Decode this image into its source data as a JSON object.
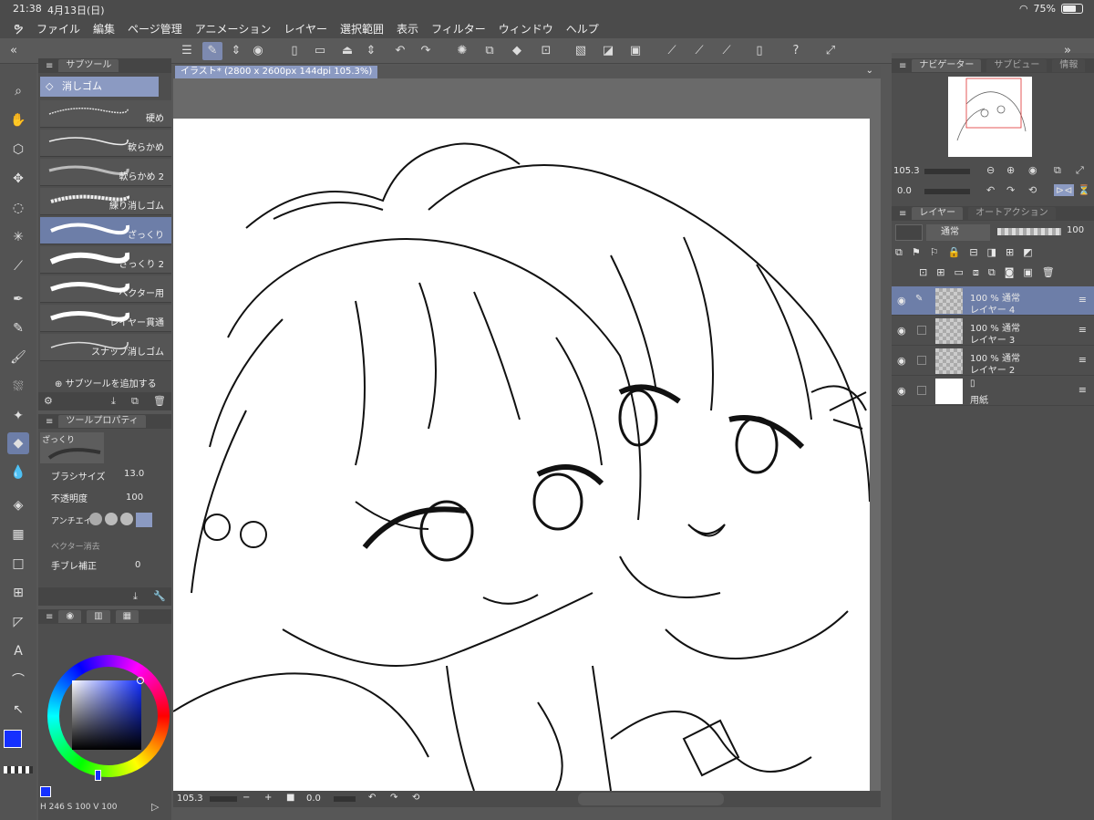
{
  "status": {
    "time": "21:38",
    "date": "4月13日(日)",
    "battery": "75%"
  },
  "menu": [
    "ファイル",
    "編集",
    "ページ管理",
    "アニメーション",
    "レイヤー",
    "選択範囲",
    "表示",
    "フィルター",
    "ウィンドウ",
    "ヘルプ"
  ],
  "subtool_panel": {
    "tab": "サブツール",
    "group": "消しゴム",
    "items": [
      {
        "label": "硬め"
      },
      {
        "label": "軟らかめ"
      },
      {
        "label": "軟らかめ 2"
      },
      {
        "label": "練り消しゴム"
      },
      {
        "label": "ざっくり"
      },
      {
        "label": "ざっくり 2"
      },
      {
        "label": "ベクター用"
      },
      {
        "label": "レイヤー貫通"
      },
      {
        "label": "スナップ消しゴム"
      }
    ],
    "add_label": "サブツールを追加する"
  },
  "tool_property": {
    "tab": "ツールプロパティ",
    "preset_name": "ざっくり",
    "brush_size_label": "ブラシサイズ",
    "brush_size_value": "13.0",
    "opacity_label": "不透明度",
    "opacity_value": "100",
    "antialias_label": "アンチエイリ",
    "vector_erase_label": "ベクター消去",
    "stabilizer_label": "手ブレ補正",
    "stabilizer_value": "0"
  },
  "color": {
    "main_color": "#1430ff",
    "values_label": "H 246 S 100 V 100"
  },
  "document": {
    "tab_title": "イラスト* (2800 x 2600px 144dpi 105.3%)"
  },
  "bottom": {
    "zoom": "105.3",
    "rotation": "0.0"
  },
  "navigator": {
    "tabs": [
      "ナビゲーター",
      "サブビュー",
      "情報"
    ],
    "zoom": "105.3",
    "rotation": "0.0"
  },
  "layers_panel": {
    "tabs": [
      "レイヤー",
      "オートアクション"
    ],
    "blend_mode": "通常",
    "opacity": "100",
    "layers": [
      {
        "percent": "100 % 通常",
        "name": "レイヤー 4"
      },
      {
        "percent": "100 % 通常",
        "name": "レイヤー 3"
      },
      {
        "percent": "100 % 通常",
        "name": "レイヤー 2"
      },
      {
        "percent": "",
        "name": "用紙"
      }
    ]
  },
  "accent": "#6d7ea8"
}
